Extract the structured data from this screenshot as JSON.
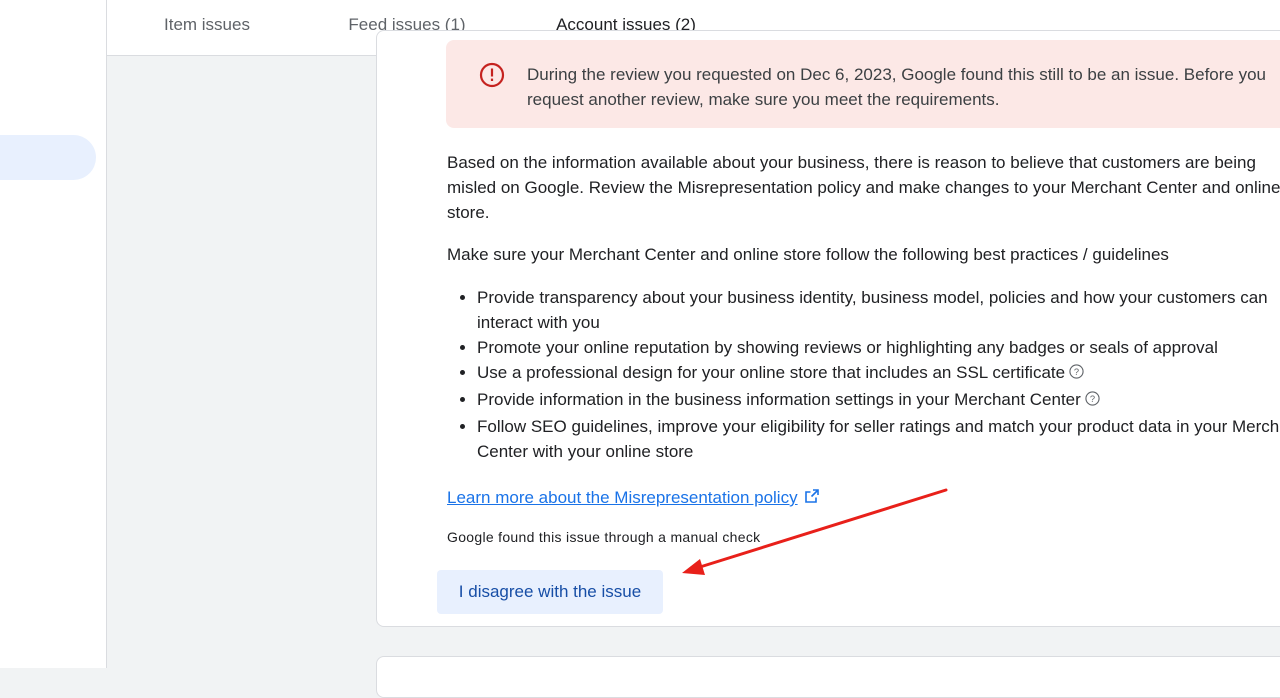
{
  "tabs": [
    {
      "label": "Item issues"
    },
    {
      "label": "Feed issues (1)"
    },
    {
      "label": "Account issues (2)",
      "active": true
    }
  ],
  "alert": {
    "icon": "error-icon",
    "text": "During the review you requested on Dec 6, 2023, Google found this still to be an issue. Before you request another review, make sure you meet the requirements."
  },
  "description": "Based on the information available about your business, there is reason to believe that customers are being misled on Google. Review the Misrepresentation policy and make changes to your Merchant Center and online store.",
  "guidelines_intro": "Make sure your Merchant Center and online store follow the following best practices / guidelines",
  "guidelines": [
    "Provide transparency about your business identity, business model, policies and how your customers can interact with you",
    "Promote your online reputation by showing reviews or highlighting any badges or seals of approval",
    "Use a professional design for your online store that includes an SSL certificate",
    "Provide information in the business information settings in your Merchant Center",
    "Follow SEO guidelines, improve your eligibility for seller ratings and match your product data in your Merchant Center with your online store"
  ],
  "learn_more_link": "Learn more about the Misrepresentation policy",
  "manual_check_note": "Google found this issue through a manual check",
  "disagree_button": "I disagree with the issue",
  "colors": {
    "accent": "#1a73e8",
    "alert_bg": "#fce8e6",
    "error": "#c5221f",
    "button_bg": "#e8f0fe",
    "button_text": "#174ea6",
    "annotation_arrow": "#e8201a"
  }
}
